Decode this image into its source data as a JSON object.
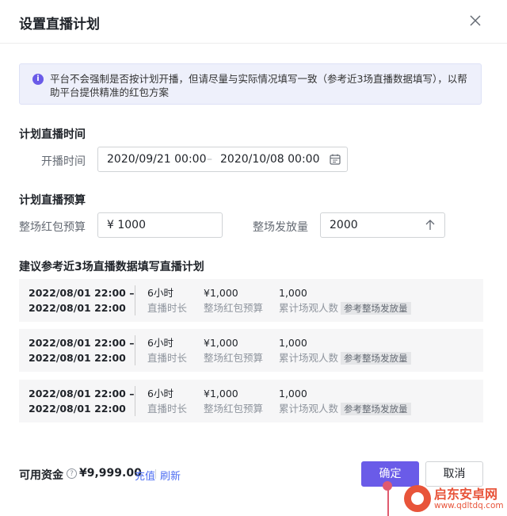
{
  "dialog": {
    "title": "设置直播计划"
  },
  "notice": {
    "text": "平台不会强制是否按计划开播，但请尽量与实际情况填写一致（参考近3场直播数据填写），以帮助平台提供精准的红包方案"
  },
  "schedule": {
    "section_title": "计划直播时间",
    "label": "开播时间",
    "start": "2020/09/21 00:00",
    "separator": "–",
    "end": "2020/10/08 00:00"
  },
  "budget": {
    "section_title": "计划直播预算",
    "red_label": "整场红包预算",
    "red_value": "¥ 1000",
    "issue_label": "整场发放量",
    "issue_value": "2000"
  },
  "reference": {
    "section_title": "建议参考近3场直播数据填写直播计划",
    "rows": [
      {
        "date_start": "2022/08/01 22:00 –",
        "date_end": "2022/08/01 22:00",
        "duration": "6小时",
        "duration_label": "直播时长",
        "budget": "¥1,000",
        "budget_label": "整场红包预算",
        "viewers": "1,000",
        "viewers_label": "累计场观人数",
        "tag": "参考整场发放量"
      },
      {
        "date_start": "2022/08/01 22:00 –",
        "date_end": "2022/08/01 22:00",
        "duration": "6小时",
        "duration_label": "直播时长",
        "budget": "¥1,000",
        "budget_label": "整场红包预算",
        "viewers": "1,000",
        "viewers_label": "累计场观人数",
        "tag": "参考整场发放量"
      },
      {
        "date_start": "2022/08/01 22:00 –",
        "date_end": "2022/08/01 22:00",
        "duration": "6小时",
        "duration_label": "直播时长",
        "budget": "¥1,000",
        "budget_label": "整场红包预算",
        "viewers": "1,000",
        "viewers_label": "累计场观人数",
        "tag": "参考整场发放量"
      }
    ]
  },
  "footer": {
    "funds_label": "可用资金",
    "funds_value": "¥9,999.00",
    "recharge": "充值",
    "refresh": "刷新",
    "confirm": "确定",
    "cancel": "取消"
  },
  "watermark": {
    "line1": "启东安卓网",
    "line2": "www.qdltdq.com"
  },
  "colors": {
    "primary": "#6a5be8",
    "link": "#4e6ef2",
    "notice_bg": "#eef0fb"
  }
}
